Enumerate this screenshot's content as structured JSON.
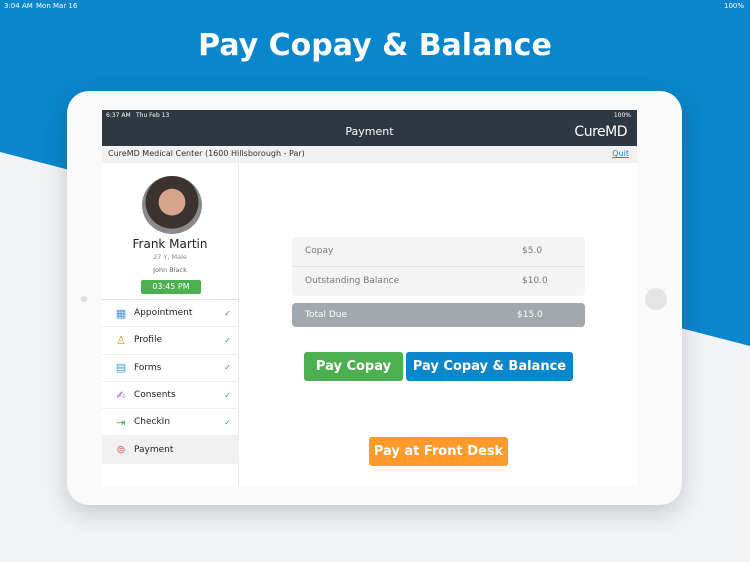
{
  "outer_status": {
    "time": "3:04 AM",
    "date": "Mon Mar 16",
    "battery": "100%"
  },
  "headline": "Pay Copay & Balance",
  "device_status": {
    "time": "6:37 AM",
    "date": "Thu Feb 13",
    "battery": "100%"
  },
  "header": {
    "title": "Payment",
    "logo": "CureMD"
  },
  "location": {
    "name": "CureMD Medical Center (1600 Hillsborough - Par)",
    "quit": "Quit"
  },
  "patient": {
    "name": "Frank Martin",
    "age_sex": "27 Y, Male",
    "provider": "John Black",
    "time": "03:45 PM"
  },
  "menu": [
    {
      "label": "Appointment",
      "icon": "calendar-icon",
      "checked": true
    },
    {
      "label": "Profile",
      "icon": "user-icon",
      "checked": true
    },
    {
      "label": "Forms",
      "icon": "document-icon",
      "checked": true
    },
    {
      "label": "Consents",
      "icon": "signature-icon",
      "checked": true
    },
    {
      "label": "CheckIn",
      "icon": "checkin-icon",
      "checked": true
    },
    {
      "label": "Payment",
      "icon": "payment-icon",
      "checked": false,
      "active": true
    }
  ],
  "payment": {
    "rows": [
      {
        "label": "Copay",
        "value": "$5.0"
      },
      {
        "label": "Outstanding Balance",
        "value": "$10.0"
      }
    ],
    "total": {
      "label": "Total Due",
      "value": "$15.0"
    },
    "pay_copay": "Pay Copay",
    "pay_both": "Pay Copay & Balance",
    "front_desk": "Pay at Front Desk"
  },
  "colors": {
    "blue": "#0a86cc",
    "green": "#4caf50",
    "orange": "#ff9a2b",
    "header": "#2e3843"
  }
}
